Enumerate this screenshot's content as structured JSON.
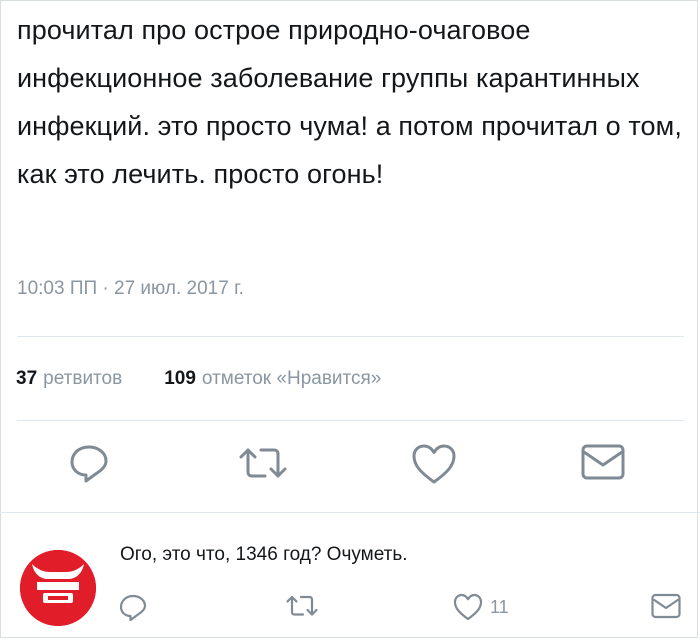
{
  "tweet": {
    "text": "прочитал про острое природно-очаговое инфекционное заболевание группы карантинных инфекций. это просто чума! а потом прочитал о том, как это лечить. просто огонь!",
    "timestamp": "10:03 ПП · 27 июл. 2017 г."
  },
  "stats": {
    "retweets_count": "37",
    "retweets_label": "ретвитов",
    "likes_count": "109",
    "likes_label": "отметок «Нравится»"
  },
  "actions": {
    "icons": [
      "reply-icon",
      "retweet-icon",
      "like-icon",
      "message-icon"
    ]
  },
  "reply": {
    "text": "Ого, это что, 1346 год? Очуметь.",
    "like_count": "11",
    "avatar_color": "#e11d2a"
  },
  "colors": {
    "text": "#14171a",
    "muted": "#8a96a1",
    "divider": "#e1e8ed",
    "avatar": "#e11d2a"
  }
}
